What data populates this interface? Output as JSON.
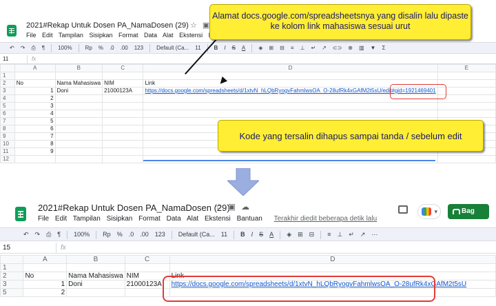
{
  "annotations": {
    "callout_top": "Alamat docs.google.com/spreadsheetsnya yang disalin lalu dipaste ke kolom link mahasiswa sesuai urut",
    "callout_middle": "Kode yang tersalin dihapus sampai tanda / sebelum edit",
    "arrow_color": "#9aaee0",
    "highlight_color": "#e53935"
  },
  "before": {
    "title": "2021#Rekap Untuk Dosen PA_NamaDosen (29)",
    "menu": [
      "File",
      "Edit",
      "Tampilan",
      "Sisipkan",
      "Format",
      "Data",
      "Alat",
      "Ekstensi",
      "Ba"
    ],
    "toolbar": {
      "zoom": "100%",
      "currency": "Rp",
      "percent": "%",
      "dec_less": ".0",
      "dec_more": ".00",
      "number_format": "123",
      "font": "Default (Ca...",
      "font_size": "11"
    },
    "name_box": "11",
    "fx_label": "fx",
    "columns": [
      "A",
      "B",
      "C",
      "D",
      "E"
    ],
    "row_numbers": [
      "1",
      "2",
      "3",
      "4",
      "5",
      "6",
      "7",
      "8",
      "9",
      "10",
      "11",
      "12"
    ],
    "header_row": {
      "no": "No",
      "nama": "Nama Mahasiswa",
      "nim": "NIM",
      "link": "Link"
    },
    "first_row": {
      "no": "1",
      "nama": "Doni",
      "nim": "21000123A",
      "link": "https://docs.google.com/spreadsheets/d/1xtvN_hLQbRyogvFahmlwsOA_O-28ufRk4xGAfM2t5sU/edit#gid=1921469401"
    },
    "numbers": [
      "2",
      "3",
      "4",
      "5",
      "6",
      "7",
      "8",
      "9"
    ]
  },
  "after": {
    "title": "2021#Rekap Untuk Dosen PA_NamaDosen (29)",
    "menu": [
      "File",
      "Edit",
      "Tampilan",
      "Sisipkan",
      "Format",
      "Data",
      "Alat",
      "Ekstensi",
      "Bantuan"
    ],
    "last_edit": "Terakhir diedit beberapa detik lalu",
    "share_label": "Bag",
    "toolbar": {
      "zoom": "100%",
      "currency": "Rp",
      "percent": "%",
      "dec_less": ".0",
      "dec_more": ".00",
      "number_format": "123",
      "font": "Default (Ca...",
      "font_size": "11"
    },
    "name_box": "15",
    "fx_label": "fx",
    "columns": [
      "A",
      "B",
      "C",
      "D"
    ],
    "row_numbers": [
      "1",
      "2",
      "3",
      "5"
    ],
    "header_row": {
      "no": "No",
      "nama": "Nama Mahasiswa",
      "nim": "NIM",
      "link": "Link"
    },
    "first_row": {
      "no": "1",
      "nama": "Doni",
      "nim": "21000123A",
      "link": "https://docs.google.com/spreadsheets/d/1xtvN_hLQbRyogvFahmlwsOA_O-28ufRk4xGAfM2t5sU"
    },
    "numbers": [
      "2"
    ]
  }
}
